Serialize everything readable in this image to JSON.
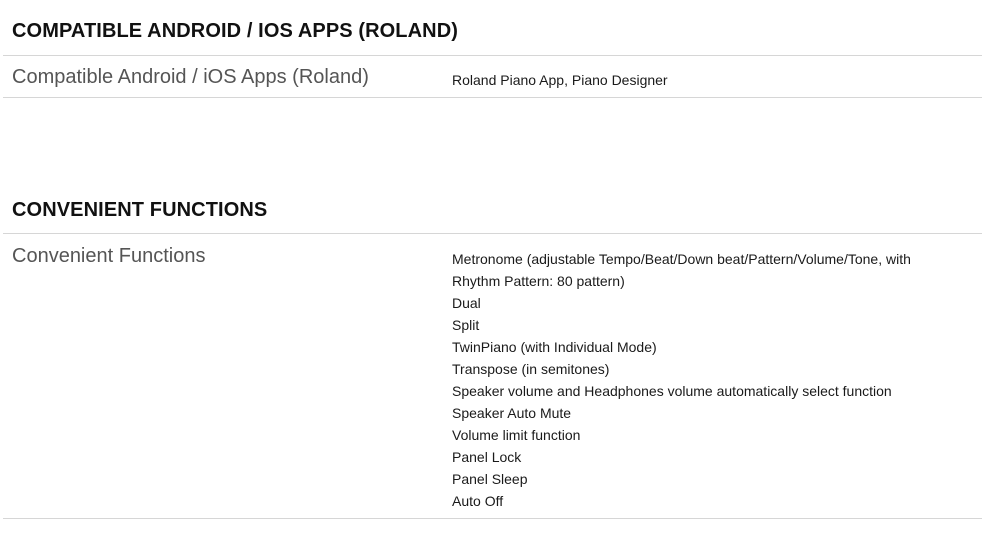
{
  "sections": [
    {
      "heading": "COMPATIBLE ANDROID / IOS APPS (ROLAND)",
      "rows": [
        {
          "label": "Compatible Android / iOS Apps (Roland)",
          "values": [
            "Roland Piano App, Piano Designer"
          ]
        }
      ]
    },
    {
      "heading": "CONVENIENT FUNCTIONS",
      "rows": [
        {
          "label": "Convenient Functions",
          "values": [
            "Metronome (adjustable Tempo/Beat/Down beat/Pattern/Volume/Tone, with",
            "Rhythm Pattern: 80 pattern)",
            "Dual",
            "Split",
            "TwinPiano (with Individual Mode)",
            "Transpose (in semitones)",
            "Speaker volume and Headphones volume automatically select function",
            "Speaker Auto Mute",
            "Volume limit function",
            "Panel Lock",
            "Panel Sleep",
            "Auto Off"
          ]
        }
      ]
    }
  ]
}
